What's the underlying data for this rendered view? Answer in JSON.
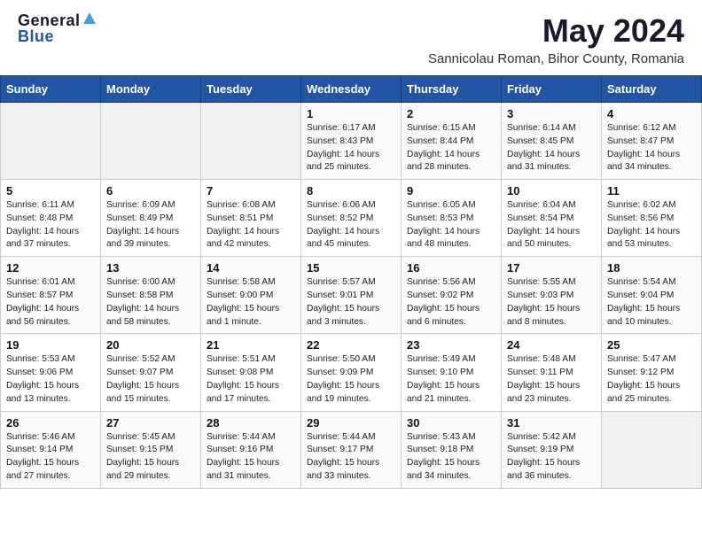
{
  "header": {
    "logo_general": "General",
    "logo_blue": "Blue",
    "month_title": "May 2024",
    "subtitle": "Sannicolau Roman, Bihor County, Romania"
  },
  "days_of_week": [
    "Sunday",
    "Monday",
    "Tuesday",
    "Wednesday",
    "Thursday",
    "Friday",
    "Saturday"
  ],
  "weeks": [
    [
      {
        "day": "",
        "info": ""
      },
      {
        "day": "",
        "info": ""
      },
      {
        "day": "",
        "info": ""
      },
      {
        "day": "1",
        "info": "Sunrise: 6:17 AM\nSunset: 8:43 PM\nDaylight: 14 hours\nand 25 minutes."
      },
      {
        "day": "2",
        "info": "Sunrise: 6:15 AM\nSunset: 8:44 PM\nDaylight: 14 hours\nand 28 minutes."
      },
      {
        "day": "3",
        "info": "Sunrise: 6:14 AM\nSunset: 8:45 PM\nDaylight: 14 hours\nand 31 minutes."
      },
      {
        "day": "4",
        "info": "Sunrise: 6:12 AM\nSunset: 8:47 PM\nDaylight: 14 hours\nand 34 minutes."
      }
    ],
    [
      {
        "day": "5",
        "info": "Sunrise: 6:11 AM\nSunset: 8:48 PM\nDaylight: 14 hours\nand 37 minutes."
      },
      {
        "day": "6",
        "info": "Sunrise: 6:09 AM\nSunset: 8:49 PM\nDaylight: 14 hours\nand 39 minutes."
      },
      {
        "day": "7",
        "info": "Sunrise: 6:08 AM\nSunset: 8:51 PM\nDaylight: 14 hours\nand 42 minutes."
      },
      {
        "day": "8",
        "info": "Sunrise: 6:06 AM\nSunset: 8:52 PM\nDaylight: 14 hours\nand 45 minutes."
      },
      {
        "day": "9",
        "info": "Sunrise: 6:05 AM\nSunset: 8:53 PM\nDaylight: 14 hours\nand 48 minutes."
      },
      {
        "day": "10",
        "info": "Sunrise: 6:04 AM\nSunset: 8:54 PM\nDaylight: 14 hours\nand 50 minutes."
      },
      {
        "day": "11",
        "info": "Sunrise: 6:02 AM\nSunset: 8:56 PM\nDaylight: 14 hours\nand 53 minutes."
      }
    ],
    [
      {
        "day": "12",
        "info": "Sunrise: 6:01 AM\nSunset: 8:57 PM\nDaylight: 14 hours\nand 56 minutes."
      },
      {
        "day": "13",
        "info": "Sunrise: 6:00 AM\nSunset: 8:58 PM\nDaylight: 14 hours\nand 58 minutes."
      },
      {
        "day": "14",
        "info": "Sunrise: 5:58 AM\nSunset: 9:00 PM\nDaylight: 15 hours\nand 1 minute."
      },
      {
        "day": "15",
        "info": "Sunrise: 5:57 AM\nSunset: 9:01 PM\nDaylight: 15 hours\nand 3 minutes."
      },
      {
        "day": "16",
        "info": "Sunrise: 5:56 AM\nSunset: 9:02 PM\nDaylight: 15 hours\nand 6 minutes."
      },
      {
        "day": "17",
        "info": "Sunrise: 5:55 AM\nSunset: 9:03 PM\nDaylight: 15 hours\nand 8 minutes."
      },
      {
        "day": "18",
        "info": "Sunrise: 5:54 AM\nSunset: 9:04 PM\nDaylight: 15 hours\nand 10 minutes."
      }
    ],
    [
      {
        "day": "19",
        "info": "Sunrise: 5:53 AM\nSunset: 9:06 PM\nDaylight: 15 hours\nand 13 minutes."
      },
      {
        "day": "20",
        "info": "Sunrise: 5:52 AM\nSunset: 9:07 PM\nDaylight: 15 hours\nand 15 minutes."
      },
      {
        "day": "21",
        "info": "Sunrise: 5:51 AM\nSunset: 9:08 PM\nDaylight: 15 hours\nand 17 minutes."
      },
      {
        "day": "22",
        "info": "Sunrise: 5:50 AM\nSunset: 9:09 PM\nDaylight: 15 hours\nand 19 minutes."
      },
      {
        "day": "23",
        "info": "Sunrise: 5:49 AM\nSunset: 9:10 PM\nDaylight: 15 hours\nand 21 minutes."
      },
      {
        "day": "24",
        "info": "Sunrise: 5:48 AM\nSunset: 9:11 PM\nDaylight: 15 hours\nand 23 minutes."
      },
      {
        "day": "25",
        "info": "Sunrise: 5:47 AM\nSunset: 9:12 PM\nDaylight: 15 hours\nand 25 minutes."
      }
    ],
    [
      {
        "day": "26",
        "info": "Sunrise: 5:46 AM\nSunset: 9:14 PM\nDaylight: 15 hours\nand 27 minutes."
      },
      {
        "day": "27",
        "info": "Sunrise: 5:45 AM\nSunset: 9:15 PM\nDaylight: 15 hours\nand 29 minutes."
      },
      {
        "day": "28",
        "info": "Sunrise: 5:44 AM\nSunset: 9:16 PM\nDaylight: 15 hours\nand 31 minutes."
      },
      {
        "day": "29",
        "info": "Sunrise: 5:44 AM\nSunset: 9:17 PM\nDaylight: 15 hours\nand 33 minutes."
      },
      {
        "day": "30",
        "info": "Sunrise: 5:43 AM\nSunset: 9:18 PM\nDaylight: 15 hours\nand 34 minutes."
      },
      {
        "day": "31",
        "info": "Sunrise: 5:42 AM\nSunset: 9:19 PM\nDaylight: 15 hours\nand 36 minutes."
      },
      {
        "day": "",
        "info": ""
      }
    ]
  ]
}
